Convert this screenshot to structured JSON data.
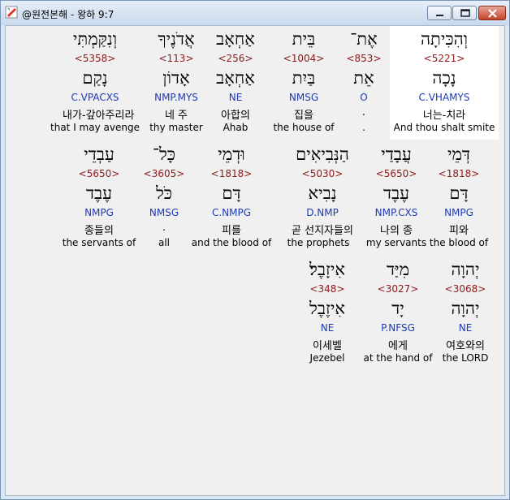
{
  "window": {
    "title": "@원전본해 - 왕하 9:7"
  },
  "rows": [
    [
      {
        "heb": "וְהִכִּיתָה",
        "num": "<5221>",
        "root": "נָכָה",
        "code": "C.VHAMYS",
        "ko": "너는-치라",
        "en": "And thou shalt smite",
        "highlight": true
      },
      {
        "heb": "אֶת־",
        "num": "<853>",
        "root": "אֵת",
        "code": "O",
        "ko": ".",
        "en": ".",
        "highlight": false
      },
      {
        "heb": "בֵּית",
        "num": "<1004>",
        "root": "בַּיִת",
        "code": "NMSG",
        "ko": "집을",
        "en": "the house of",
        "highlight": false
      },
      {
        "heb": "אַחְאָב",
        "num": "<256>",
        "root": "אַחְאָב",
        "code": "NE",
        "ko": "아합의",
        "en": "Ahab",
        "highlight": false
      },
      {
        "heb": "אֲדֹנֶיךָ",
        "num": "<113>",
        "root": "אָדוֹן",
        "code": "NMP.MYS",
        "ko": "네 주",
        "en": "thy master",
        "highlight": false
      },
      {
        "heb": "וְנִקַּמְתִּי",
        "num": "<5358>",
        "root": "נָקַם",
        "code": "C.VPACXS",
        "ko": "내가-갚아주리라",
        "en": "that I may avenge",
        "highlight": false
      }
    ],
    [
      {
        "heb": "דְּמֵי",
        "num": "<1818>",
        "root": "דָּם",
        "code": "NMPG",
        "ko": "피와",
        "en": "the blood of",
        "highlight": false
      },
      {
        "heb": "עֲבָדַי",
        "num": "<5650>",
        "root": "עֶבֶד",
        "code": "NMP.CXS",
        "ko": "나의 종",
        "en": "my servants",
        "highlight": false
      },
      {
        "heb": "הַנְּבִיאִים",
        "num": "<5030>",
        "root": "נָבִיא",
        "code": "D.NMP",
        "ko": "곧 선지자들의",
        "en": "the prophets",
        "highlight": false
      },
      {
        "heb": "וּדְמֵי",
        "num": "<1818>",
        "root": "דָּם",
        "code": "C.NMPG",
        "ko": "피를",
        "en": "and the blood of",
        "highlight": false
      },
      {
        "heb": "כָּל־",
        "num": "<3605>",
        "root": "כֹּל",
        "code": "NMSG",
        "ko": ".",
        "en": "all",
        "highlight": false
      },
      {
        "heb": "עַבְדֵי",
        "num": "<5650>",
        "root": "עֶבֶד",
        "code": "NMPG",
        "ko": "종들의",
        "en": "the servants of",
        "highlight": false
      }
    ],
    [
      {
        "heb": "יְהוָה",
        "num": "<3068>",
        "root": "יְהוָה",
        "code": "NE",
        "ko": "여호와의",
        "en": "the LORD",
        "highlight": false
      },
      {
        "heb": "מִיַּד",
        "num": "<3027>",
        "root": "יָד",
        "code": "P.NFSG",
        "ko": "에게",
        "en": "at the hand of",
        "highlight": false
      },
      {
        "heb": "אִיזָבֶל׃",
        "num": "<348>",
        "root": "אִיזֶבֶל",
        "code": "NE",
        "ko": "이세벨",
        "en": "Jezebel",
        "highlight": false
      }
    ]
  ]
}
